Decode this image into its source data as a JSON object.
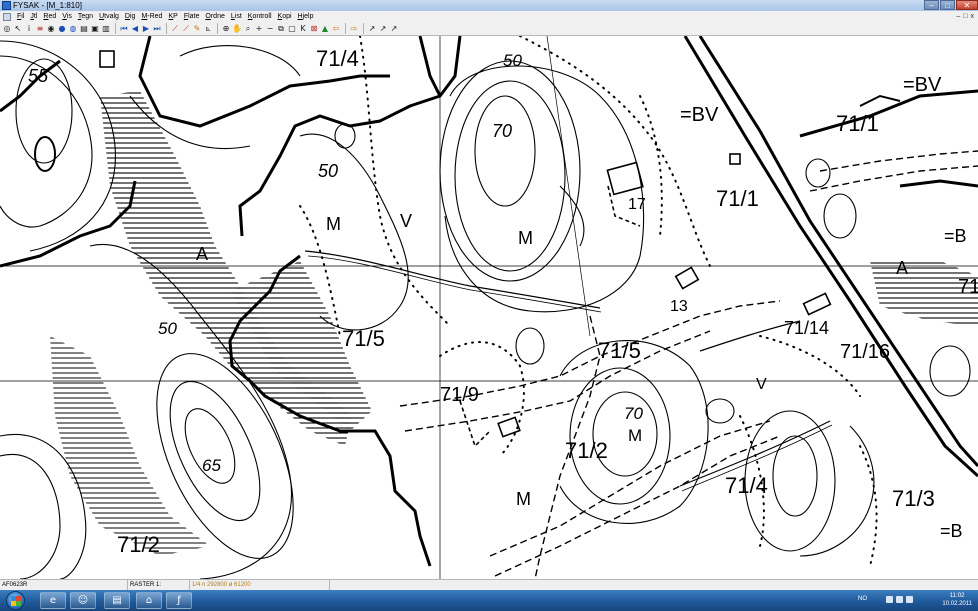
{
  "window": {
    "title": "FYSAK - [M_1:810]",
    "buttons": [
      "–",
      "□",
      "✕"
    ]
  },
  "menu": {
    "items": [
      "Fil",
      "Jtl",
      "Red",
      "Vis",
      "Tegn",
      "Utvalg",
      "Dig",
      "M-Red",
      "KP",
      "Flate",
      "Ordne",
      "List",
      "Kontroll",
      "Kopi",
      "Hjelp"
    ],
    "mdi_controls": [
      "–",
      "□",
      "x"
    ]
  },
  "toolbar": {
    "icons": [
      "globe-icon",
      "pointer-icon",
      "info-icon",
      "layers-icon",
      "zoom-extent-icon",
      "globe-fill-icon",
      "globe-outline-icon",
      "folder-open-icon",
      "save-icon",
      "print-icon",
      "first-icon",
      "previous-icon",
      "next-icon",
      "last-icon",
      "draw-line-icon",
      "draw-line-2-icon",
      "edit-line-icon",
      "measure-icon",
      "zoom-in-icon",
      "pan-icon",
      "zoom-window-icon",
      "plus-icon",
      "minus-icon",
      "copy-icon",
      "new-object-icon",
      "snap-icon",
      "delete-icon",
      "color-icon",
      "back-icon",
      "forward-icon",
      "tool-a-icon",
      "tool-b-icon",
      "tool-c-icon"
    ],
    "glyphs": [
      "◎",
      "↖",
      "i",
      "≡",
      "◉",
      "●",
      "◍",
      "▤",
      "▣",
      "▥",
      "⏮",
      "◀",
      "▶",
      "⏭",
      "⟋",
      "⟋",
      "✎",
      "⦝",
      "⊕",
      "✋",
      "⌕",
      "+",
      "−",
      "⧉",
      "▢",
      "K",
      "⊠",
      "▲",
      "⇦",
      "⇨",
      "↗",
      "↗",
      "↗"
    ]
  },
  "map": {
    "labels": [
      {
        "text": "55",
        "italic": true
      },
      {
        "text": "71/4",
        "italic": false
      },
      {
        "text": "50",
        "italic": true
      },
      {
        "text": "=BV",
        "italic": false
      },
      {
        "text": "=BV",
        "italic": false
      },
      {
        "text": "71/1",
        "italic": false
      },
      {
        "text": "70",
        "italic": true
      },
      {
        "text": "50",
        "italic": true
      },
      {
        "text": "17",
        "italic": false
      },
      {
        "text": "71/1",
        "italic": false
      },
      {
        "text": "M",
        "italic": false
      },
      {
        "text": "V",
        "italic": false
      },
      {
        "text": "M",
        "italic": false
      },
      {
        "text": "A",
        "italic": false
      },
      {
        "text": "=B",
        "italic": false
      },
      {
        "text": "A",
        "italic": false
      },
      {
        "text": "71",
        "italic": false
      },
      {
        "text": "13",
        "italic": false
      },
      {
        "text": "50",
        "italic": true
      },
      {
        "text": "71/5",
        "italic": false
      },
      {
        "text": "71/5",
        "italic": false
      },
      {
        "text": "71/14",
        "italic": false
      },
      {
        "text": "71/16",
        "italic": false
      },
      {
        "text": "V",
        "italic": false
      },
      {
        "text": "71/9",
        "italic": false
      },
      {
        "text": "70",
        "italic": true
      },
      {
        "text": "M",
        "italic": false
      },
      {
        "text": "71/2",
        "italic": false
      },
      {
        "text": "65",
        "italic": true
      },
      {
        "text": "71/4",
        "italic": false
      },
      {
        "text": "M",
        "italic": false
      },
      {
        "text": "71/3",
        "italic": false
      },
      {
        "text": "=B",
        "italic": false
      },
      {
        "text": "71/2",
        "italic": false
      }
    ]
  },
  "status": {
    "file": "AF0623R",
    "raster": "RASTER 1:",
    "coords": "1/4  n 292800  ø 61200"
  },
  "taskbar": {
    "apps": [
      "ie-icon",
      "folder-icon",
      "explorer-icon",
      "fysak-icon",
      "app-icon"
    ],
    "app_glyphs": [
      "e",
      "☺",
      "▤",
      "⌂",
      "ƒ"
    ],
    "language": "NO",
    "time": "11:02",
    "date": "10.02.2011"
  }
}
